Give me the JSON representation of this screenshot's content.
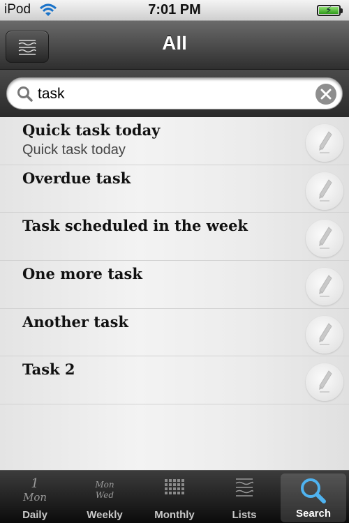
{
  "status": {
    "carrier": "iPod",
    "time": "7:01 PM"
  },
  "nav": {
    "title": "All"
  },
  "search": {
    "value": "task"
  },
  "tasks": [
    {
      "title": "Quick task today",
      "subtitle": "Quick task today"
    },
    {
      "title": "Overdue task",
      "subtitle": ""
    },
    {
      "title": "Task scheduled in the week",
      "subtitle": ""
    },
    {
      "title": "One more task",
      "subtitle": ""
    },
    {
      "title": "Another task",
      "subtitle": ""
    },
    {
      "title": "Task 2",
      "subtitle": ""
    }
  ],
  "tabs": [
    {
      "label": "Daily",
      "icon_text_top": "1",
      "icon_text_bottom": "Mon"
    },
    {
      "label": "Weekly",
      "icon_text_top": "Mon",
      "icon_text_bottom": "Wed"
    },
    {
      "label": "Monthly"
    },
    {
      "label": "Lists"
    },
    {
      "label": "Search"
    }
  ],
  "colors": {
    "selected_tab_icon": "#4fb3f0",
    "nav_bg": "#3a3a3a",
    "battery": "#3fae2a"
  }
}
